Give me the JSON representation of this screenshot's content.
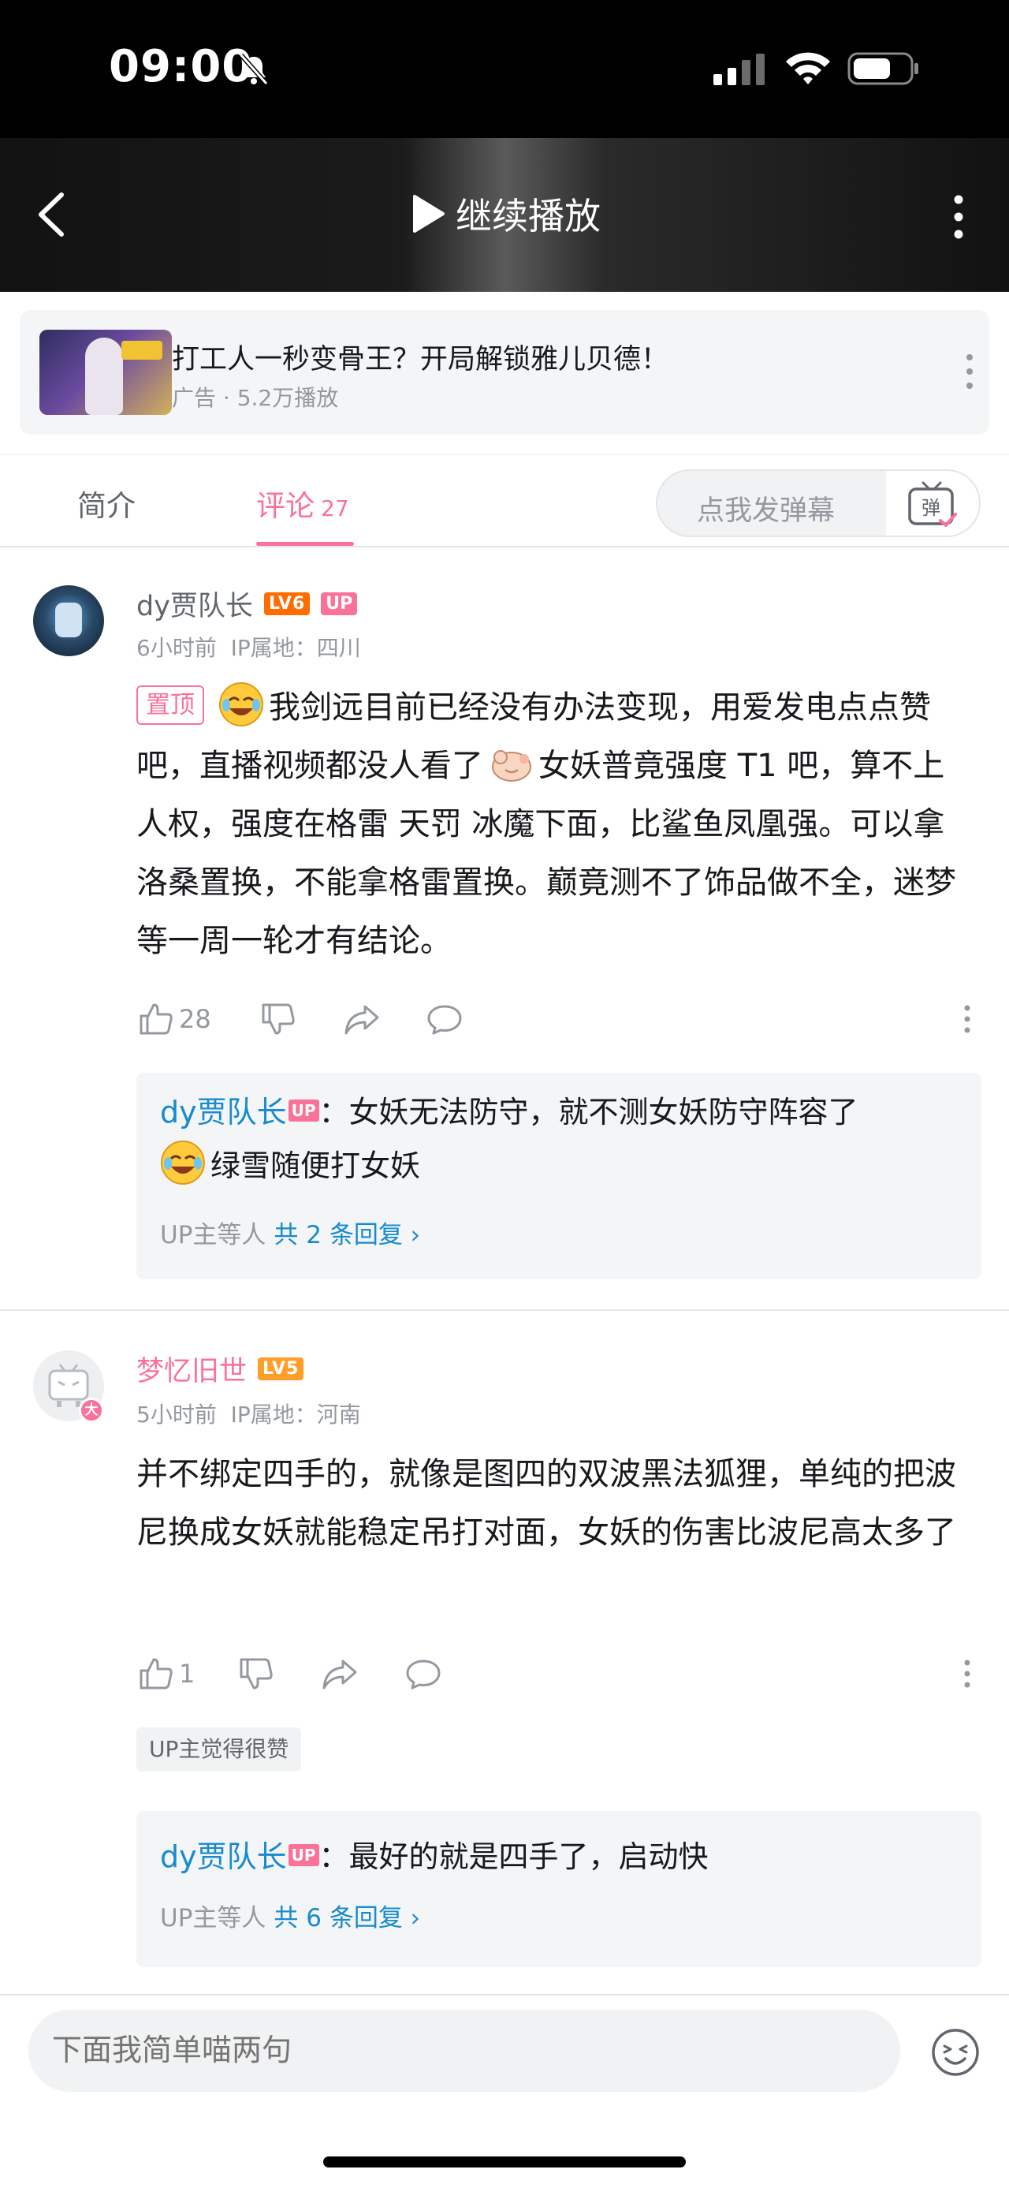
{
  "status_bar": {
    "time": "09:00"
  },
  "video_header": {
    "continue_label": "继续播放"
  },
  "ad": {
    "title": "打工人一秒变骨王？开局解锁雅儿贝德！",
    "meta": "广告 · 5.2万播放"
  },
  "tabs": {
    "intro": "简介",
    "comments": "评论",
    "comments_count": "27"
  },
  "danmaku": {
    "placeholder": "点我发弹幕",
    "button": "弹"
  },
  "comments": [
    {
      "username": "dy贾队长",
      "level": "LV6",
      "up_badge": "UP",
      "time": "6小时前",
      "ip": "IP属地：四川",
      "pinned_label": "置顶",
      "text_1": "我剑远目前已经没有办法变现，用爱发电点点赞吧，直播视频都没人看了",
      "text_2": "女妖普竟强度 T1 吧，算不上人权，强度在格雷 天罚 冰魔下面，比鲨鱼凤凰强。可以拿洛桑置换，不能拿格雷置换。巅竟测不了饰品做不全，迷梦等一周一轮才有结论。",
      "likes": "28",
      "reply": {
        "name": "dy贾队长",
        "up_badge": "UP",
        "text_1": "：女妖无法防守，就不测女妖防守阵容了",
        "text_2": "绿雪随便打女妖",
        "more_prefix": "UP主等人",
        "more_total": "共 2 条回复 ›"
      }
    },
    {
      "username": "梦忆旧世",
      "level": "LV5",
      "avatar_badge": "大",
      "time": "5小时前",
      "ip": "IP属地：河南",
      "text": "并不绑定四手的，就像是图四的双波黑法狐狸，单纯的把波尼换成女妖就能稳定吊打对面，女妖的伤害比波尼高太多了",
      "likes": "1",
      "praise": "UP主觉得很赞",
      "reply": {
        "name": "dy贾队长",
        "up_badge": "UP",
        "text": "：最好的就是四手了，启动快",
        "more_prefix": "UP主等人",
        "more_total": "共 6 条回复 ›"
      }
    }
  ],
  "bottom_bar": {
    "input_placeholder": "下面我简单喵两句"
  },
  "colors": {
    "accent": "#fb7299",
    "link": "#178bcf",
    "level6": "#ff6c00",
    "level5": "#ff9f2a"
  }
}
